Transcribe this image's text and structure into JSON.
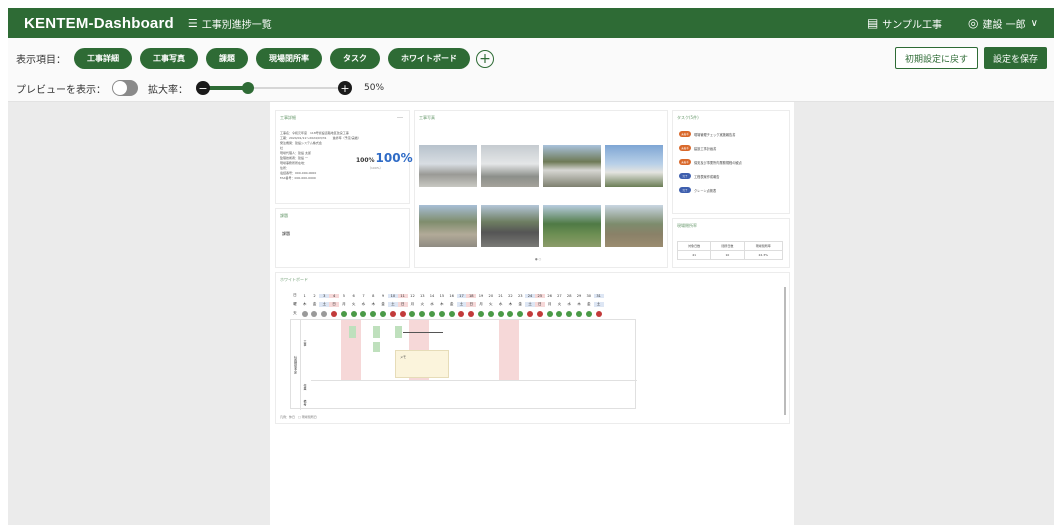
{
  "header": {
    "brand": "KENTEM-Dashboard",
    "nav_label": "工事別進捗一覧",
    "project": "サンプル工事",
    "user": "建設 一郎",
    "chevron": "∨"
  },
  "toolbar": {
    "items_label": "表示項目：",
    "chips": [
      "工事詳細",
      "工事写真",
      "課題",
      "現場閉所率",
      "タスク",
      "ホワイトボード"
    ],
    "preview_label": "プレビューを表示：",
    "zoom_label": "拡大率：",
    "zoom_value": "50%",
    "zoom_fraction": 0.5,
    "reset_label": "初期設定に戻す",
    "save_label": "設定を保存"
  },
  "detail": {
    "title": "工事詳細",
    "more": "…",
    "lines": [
      "工事名：令和元年度　118号仮設道路地区改良工事",
      "工期：2024/01/11〜2024/03/31　　進捗率（予定/実績）",
      "発注機関：建設システム株式会",
      "社",
      "現場代理人：建設 太郎",
      "監理技術者：建設 一",
      "現場事務所所在地：",
      "住所：",
      ""
    ],
    "phone": "電話番号：000-000-0000",
    "fax": "FAX番号：000-000-0000",
    "progress_a": "100%",
    "progress_b": "100%",
    "progress_note": "（100%）"
  },
  "issue": {
    "title": "課題",
    "text": "課題"
  },
  "photos": {
    "title": "工事写真",
    "pager": "● ○"
  },
  "tasks": {
    "title": "タスク(5件)",
    "items": [
      {
        "badge": "未着手",
        "text": "現場管理チェック実施報告書"
      },
      {
        "badge": "未着手",
        "text": "建設工事計画書"
      },
      {
        "badge": "未着手",
        "text": "保安及び事業所内業務規程の観点"
      },
      {
        "badge": "完了",
        "text": "工程表案作成報告"
      },
      {
        "badge": "完了",
        "text": "クレーン点検表"
      }
    ]
  },
  "closure": {
    "title": "現場閉所率",
    "headers": [
      "対象日数",
      "閉所日数",
      "現場閉所率"
    ],
    "values": [
      "41",
      "10",
      "22.3%"
    ]
  },
  "whiteboard": {
    "title": "ホワイトボード",
    "row_label_day": "日",
    "row_label_wd": "曜",
    "row_label_wx": "天",
    "days": [
      "1",
      "2",
      "3",
      "4",
      "5",
      "6",
      "7",
      "8",
      "9",
      "10",
      "11",
      "12",
      "13",
      "14",
      "15",
      "16",
      "17",
      "18",
      "19",
      "20",
      "21",
      "22",
      "23",
      "24",
      "25",
      "26",
      "27",
      "28",
      "29",
      "30",
      "31"
    ],
    "weekdays": [
      "木",
      "金",
      "土",
      "日",
      "月",
      "火",
      "水",
      "木",
      "金",
      "土",
      "日",
      "月",
      "火",
      "水",
      "木",
      "金",
      "土",
      "日",
      "月",
      "火",
      "水",
      "木",
      "金",
      "土",
      "日",
      "月",
      "火",
      "水",
      "木",
      "金",
      "土"
    ],
    "side_label": "社員現場予定",
    "side_a": "工事",
    "side_b": "作業",
    "side_c": "備考",
    "note_title": "メモ",
    "legend": "凡例：休日　□ 現場閉所日",
    "colors": {
      "holiday": "#f6d8d8",
      "sat": "#dde6f4",
      "ok": "#4a9a47",
      "ng": "#c23a3a",
      "gray": "#9a9a9a"
    }
  }
}
